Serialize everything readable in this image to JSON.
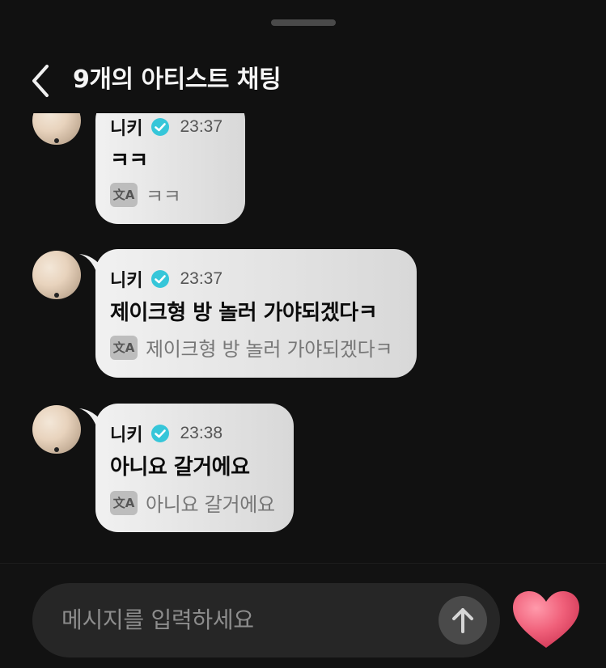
{
  "header": {
    "title": "9개의 아티스트 채팅"
  },
  "messages": [
    {
      "name": "니키",
      "time": "23:37",
      "text": "ㅋㅋ",
      "translation": "ㅋㅋ"
    },
    {
      "name": "니키",
      "time": "23:37",
      "text": "제이크형 방 놀러 가야되겠다ㅋ",
      "translation": "제이크형 방 놀러 가야되겠다ㅋ"
    },
    {
      "name": "니키",
      "time": "23:38",
      "text": "아니요 갈거에요",
      "translation": "아니요 갈거에요"
    }
  ],
  "translate_icon_label": "文A",
  "composer": {
    "placeholder": "메시지를 입력하세요"
  },
  "icons": {
    "back": "chevron-left-icon",
    "verified": "verified-check-icon",
    "translate": "translate-icon",
    "send": "arrow-up-icon",
    "like": "heart-icon"
  },
  "colors": {
    "background": "#111111",
    "bubble": "#e6e6e6",
    "verified": "#36c6d9",
    "heart": "#f0607a",
    "input": "#262626"
  }
}
